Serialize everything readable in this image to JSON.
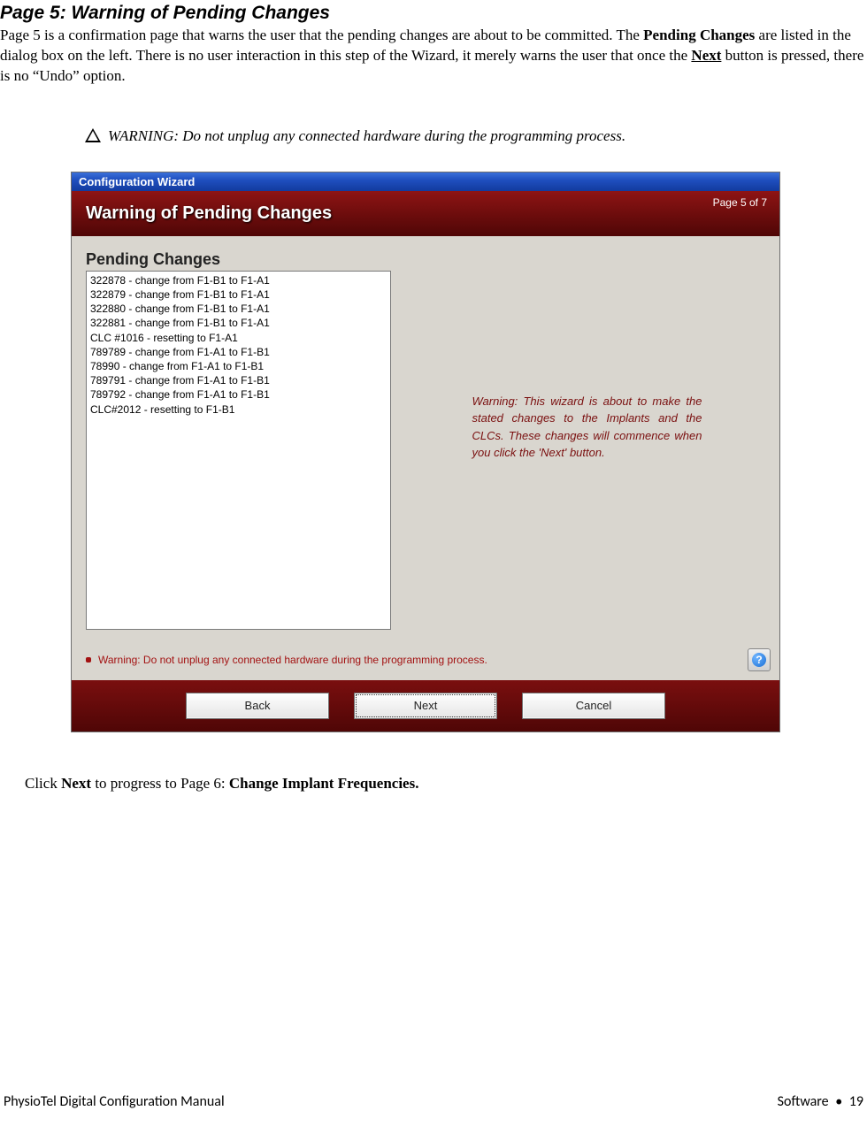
{
  "doc": {
    "heading": "Page 5: Warning of Pending Changes",
    "para_parts": {
      "a": "Page 5 is a confirmation page that warns the user that the pending changes are about to be committed.  The ",
      "b_bold": "Pending Changes",
      "c": " are listed in the dialog box on the left.  There is no user interaction in this step of the Wizard, it merely warns the user that once the ",
      "d_bold": "Next",
      "e": " button is pressed, there is no “Undo” option."
    },
    "warning_italic": "WARNING: Do not unplug any connected hardware during the programming process.",
    "after": {
      "a": "Click ",
      "b_bold": "Next",
      "c": " to progress to Page 6: ",
      "d_bold": "Change Implant Frequencies."
    }
  },
  "wizard": {
    "titlebar": "Configuration Wizard",
    "page_indicator": "Page 5 of 7",
    "header_title": "Warning of Pending Changes",
    "pending_label": "Pending Changes",
    "pending_items": [
      "322878 - change from F1-B1 to F1-A1",
      "322879 - change from F1-B1 to F1-A1",
      "322880 - change from F1-B1 to F1-A1",
      "322881 - change from F1-B1 to F1-A1",
      "CLC #1016 - resetting to F1-A1",
      "789789 - change from F1-A1 to F1-B1",
      "78990 - change from F1-A1 to F1-B1",
      "789791 - change from F1-A1 to F1-B1",
      "789792 - change from F1-A1 to F1-B1",
      "CLC#2012 - resetting to F1-B1"
    ],
    "right_warning": "Warning: This wizard is about to make the stated changes to the Implants and the CLCs.  These changes will commence when you click the 'Next' button.",
    "status_text": "Warning: Do not unplug any connected hardware during the programming process.",
    "help_char": "?",
    "buttons": {
      "back": "Back",
      "next": "Next",
      "cancel": "Cancel"
    }
  },
  "footer": {
    "left": "PhysioTel Digital Configuration Manual",
    "right_section": "Software",
    "right_page": "19"
  }
}
